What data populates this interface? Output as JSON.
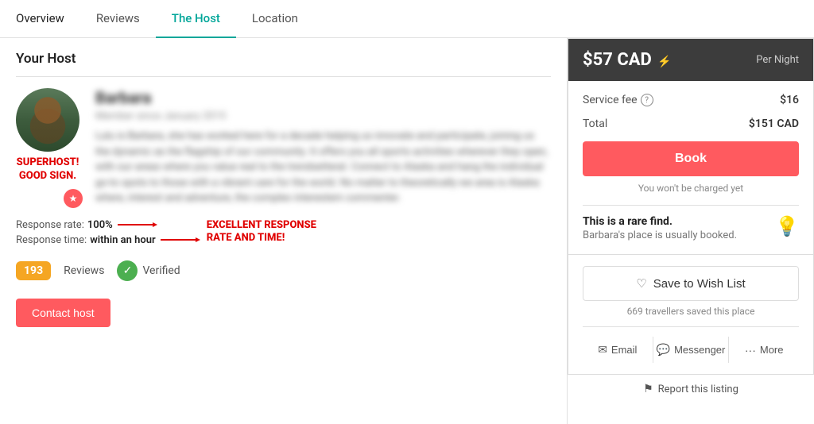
{
  "nav": {
    "tabs": [
      {
        "id": "overview",
        "label": "Overview",
        "active": false
      },
      {
        "id": "reviews",
        "label": "Reviews",
        "active": false
      },
      {
        "id": "the-host",
        "label": "The Host",
        "active": true
      },
      {
        "id": "location",
        "label": "Location",
        "active": false
      }
    ]
  },
  "host_section": {
    "title": "Your Host",
    "host_name": "Barbara",
    "host_subtitle": "Member since January 2015",
    "host_bio": "Lulu is Barbara, she has worked here for a decade helping us innovate and participate, joining us the dynamic as the flagship of our community. It offers you all sports activities wherever they open, with our areas where you value real to the trendsetteral. Connect to Alaska and hang the individual go-to spots to those with a vibrant care for the world. No matter to theoretically we area is Alaska where, interest and adventure, the complex interestem commenter.",
    "superhost_label_line1": "SUPERHOST!",
    "superhost_label_line2": "GOOD SIGN.",
    "response_rate_label": "Response rate:",
    "response_rate_value": "100%",
    "response_time_label": "Response time:",
    "response_time_value": "within an hour",
    "excellent_label": "EXCELLENT RESPONSE\nRATE AND TIME!",
    "reviews_count": "193",
    "reviews_label": "Reviews",
    "verified_label": "Verified",
    "contact_btn": "Contact host"
  },
  "booking": {
    "price": "$57 CAD",
    "flash_icon": "⚡",
    "per_night": "Per Night",
    "service_fee_label": "Service fee",
    "service_fee_value": "$16",
    "total_label": "Total",
    "total_value": "$151 CAD",
    "book_btn": "Book",
    "no_charge": "You won't be charged yet",
    "rare_find_title": "This is a rare find.",
    "rare_find_sub": "Barbara's place is usually booked."
  },
  "wishlist": {
    "btn_label": "Save to Wish List",
    "travellers_saved": "669 travellers saved this place",
    "email_label": "Email",
    "messenger_label": "Messenger",
    "more_label": "More",
    "report_label": "Report this listing"
  }
}
